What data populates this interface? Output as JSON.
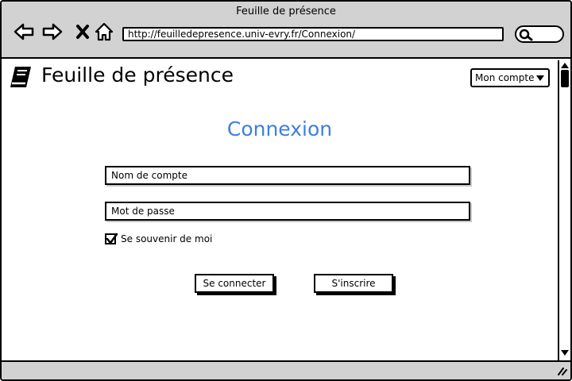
{
  "window": {
    "title": "Feuille de présence"
  },
  "toolbar": {
    "url": "http://feuilledepresence.univ-evry.fr/Connexion/",
    "icons": [
      "back-icon",
      "forward-icon",
      "close-icon",
      "home-icon",
      "search-icon"
    ]
  },
  "header": {
    "app_title": "Feuille de présence",
    "logo_icon": "book-icon",
    "account_select": {
      "selected": "Mon compte"
    }
  },
  "login": {
    "title": "Connexion",
    "username_field": {
      "value": "Nom de compte"
    },
    "password_field": {
      "value": "Mot de passe"
    },
    "remember": {
      "label": "Se souvenir de moi",
      "checked": true
    },
    "login_button": "Se connecter",
    "register_button": "S'inscrire"
  },
  "colors": {
    "accent": "#3d7fe0",
    "chrome": "#d2d2d2"
  }
}
